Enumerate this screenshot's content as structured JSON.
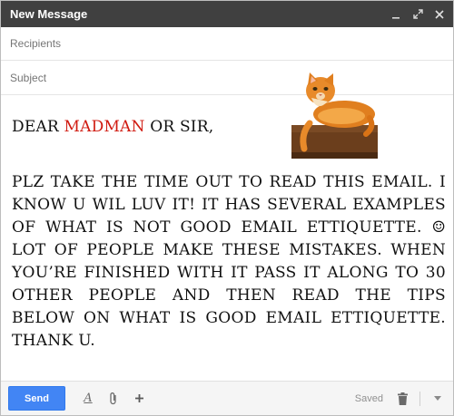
{
  "window": {
    "title": "New Message"
  },
  "fields": {
    "recipients_placeholder": "Recipients",
    "subject_placeholder": "Subject"
  },
  "body": {
    "greeting_prefix": "DEAR ",
    "greeting_highlight": "MADMAN",
    "greeting_suffix": " OR SIR,",
    "highlight_color": "#d01a10",
    "message": "PLZ TAKE THE TIME OUT TO READ THIS EMAIL. I KNOW U WIL LUV IT! IT HAS SEVERAL EXAMPLES OF WHAT IS NOT GOOD EMAIL ETTIQUETTE. ☺ LOT OF PEOPLE MAKE THESE MISTAKES. WHEN YOU’RE FINISHED WITH IT PASS IT ALONG TO 30 OTHER PEOPLE AND THEN READ THE TIPS BELOW ON WHAT IS GOOD EMAIL ETTIQUETTE. THANK U."
  },
  "toolbar": {
    "send_label": "Send",
    "saved_label": "Saved",
    "send_color": "#4285f4"
  }
}
